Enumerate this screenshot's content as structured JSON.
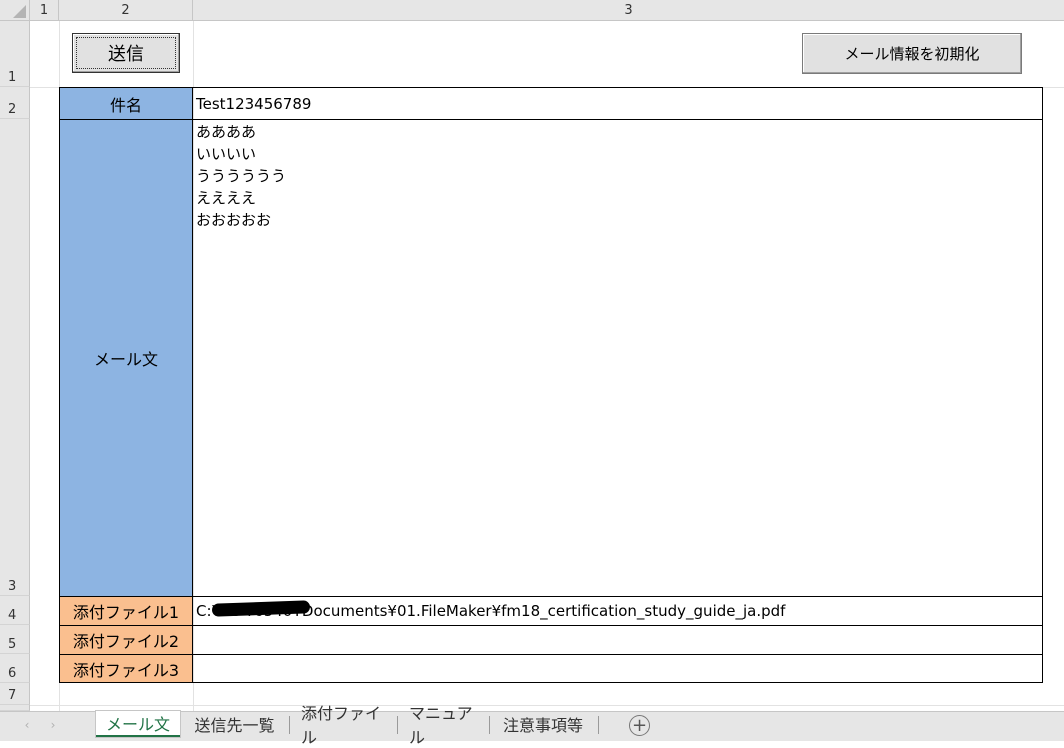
{
  "column_headers": [
    "1",
    "2",
    "3"
  ],
  "row_headers": [
    "1",
    "2",
    "3",
    "4",
    "5",
    "6",
    "7"
  ],
  "buttons": {
    "send": "送信",
    "reset": "メール情報を初期化"
  },
  "form": {
    "subject_label": "件名",
    "subject_value": "Test123456789",
    "body_label": "メール文",
    "body_value": "ああああ\nいいいい\nうううううう\nええええ\nおおおおお",
    "attachment1_label": "添付ファイル1",
    "attachment1_value": "C:¥Us     ¥6540¥Documents¥01.FileMaker¥fm18_certification_study_guide_ja.pdf",
    "attachment2_label": "添付ファイル2",
    "attachment2_value": "",
    "attachment3_label": "添付ファイル3",
    "attachment3_value": ""
  },
  "sheet_tabs": {
    "active": "メール文",
    "items": [
      "メール文",
      "送信先一覧",
      "添付ファイル",
      "マニュアル",
      "注意事項等"
    ]
  },
  "colors": {
    "label_blue": "#8db4e2",
    "label_orange": "#fabf8f",
    "active_tab": "#217346"
  },
  "icons": {
    "nav_prev": "‹",
    "nav_next": "›",
    "add_sheet": "+"
  }
}
